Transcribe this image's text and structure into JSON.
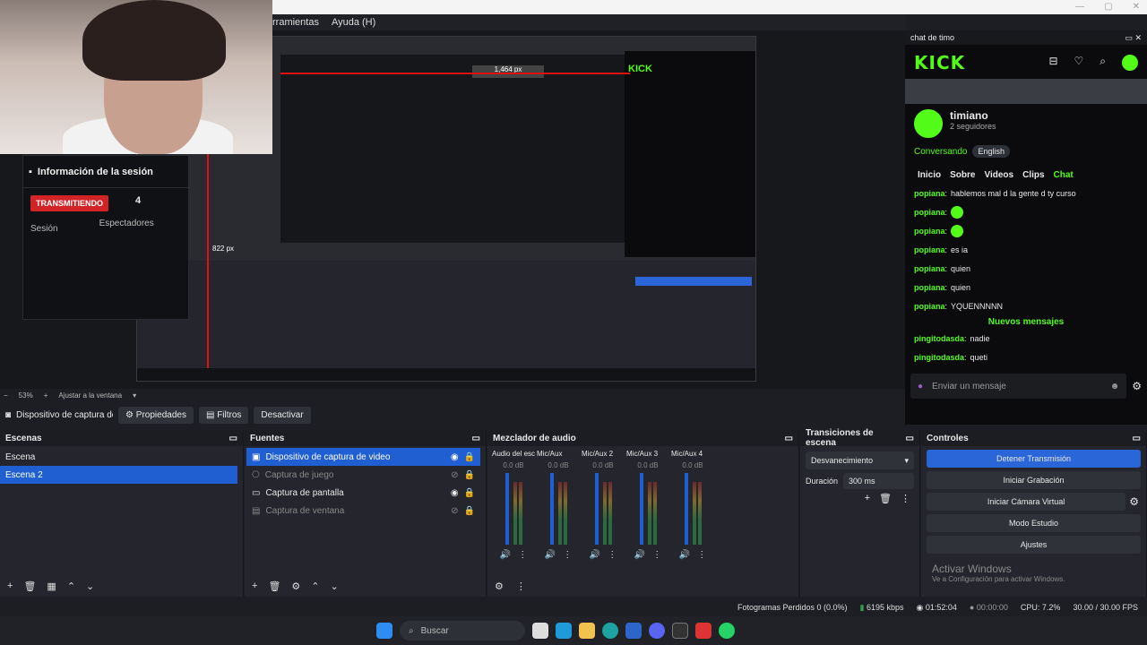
{
  "menubar": {
    "items": [
      "rramientas",
      "Ayuda (H)"
    ]
  },
  "session": {
    "title": "Información de la sesión",
    "live_label": "TRANSMITIENDO",
    "viewers_value": "4",
    "session_label": "Sesión",
    "viewers_label": "Espectadores"
  },
  "preview_overlay": {
    "measure_top": "1,464 px",
    "measure_left": "822 px"
  },
  "zoombar": {
    "zoom": "53%",
    "fit": "Ajustar a la ventana"
  },
  "source_bar": {
    "source_name": "Dispositivo de captura de v",
    "properties": "Propiedades",
    "filters": "Filtros",
    "deactivate": "Desactivar"
  },
  "scenes": {
    "title": "Escenas",
    "items": [
      "Escena",
      "Escena 2"
    ]
  },
  "sources": {
    "title": "Fuentes",
    "items": [
      {
        "label": "Dispositivo de captura de video",
        "enabled": true
      },
      {
        "label": "Captura de juego",
        "enabled": false
      },
      {
        "label": "Captura de pantalla",
        "enabled": true
      },
      {
        "label": "Captura de ventana",
        "enabled": false
      }
    ]
  },
  "mixer": {
    "title": "Mezclador de audio",
    "channels": [
      {
        "name": "Audio del escritorio",
        "db": "0.0 dB"
      },
      {
        "name": "Mic/Aux",
        "db": "0.0 dB"
      },
      {
        "name": "Mic/Aux 2",
        "db": "0.0 dB"
      },
      {
        "name": "Mic/Aux 3",
        "db": "0.0 dB"
      },
      {
        "name": "Mic/Aux 4",
        "db": "0.0 dB"
      }
    ],
    "scale": [
      "-5",
      "-10",
      "-15",
      "-20",
      "-25",
      "-30",
      "-35",
      "-40",
      "-45",
      "-50",
      "-55",
      "-60"
    ]
  },
  "transitions": {
    "title": "Transiciones de escena",
    "selected": "Desvanecimiento",
    "duration_label": "Duración",
    "duration_value": "300 ms"
  },
  "controls": {
    "title": "Controles",
    "buttons": [
      "Detener Transmisión",
      "Iniciar Grabación",
      "Iniciar Cámara Virtual",
      "Modo Estudio",
      "Ajustes"
    ],
    "watermark_title": "Activar Windows",
    "watermark_sub": "Ve a Configuración para activar Windows."
  },
  "chat": {
    "window_title": "chat de timo",
    "logo": "KICK",
    "username": "timiano",
    "followers": "2 seguidores",
    "status": "Conversando",
    "language": "English",
    "tabs": [
      "Inicio",
      "Sobre",
      "Videos",
      "Clips",
      "Chat"
    ],
    "messages": [
      {
        "user": "popiana",
        "text": "hablemos mal d la gente d ty curso",
        "emote": false
      },
      {
        "user": "popiana",
        "text": "",
        "emote": true
      },
      {
        "user": "popiana",
        "text": "",
        "emote": true
      },
      {
        "user": "popiana",
        "text": "es ia",
        "emote": false
      },
      {
        "user": "popiana",
        "text": "quien",
        "emote": false
      },
      {
        "user": "popiana",
        "text": "quien",
        "emote": false
      },
      {
        "user": "popiana",
        "text": "YQUENNNNN",
        "emote": false
      }
    ],
    "new_messages": "Nuevos mensajes",
    "messages_after": [
      {
        "user": "pingitodasda",
        "text": "nadie"
      },
      {
        "user": "pingitodasda",
        "text": "queti"
      }
    ],
    "input_placeholder": "Enviar un mensaje",
    "accent": "#53fc18"
  },
  "status": {
    "dropped": "Fotogramas Perdidos 0 (0.0%)",
    "bitrate": "6195 kbps",
    "live_time": "01:52:04",
    "rec_time": "00:00:00",
    "cpu": "CPU: 7.2%",
    "fps": "30.00 / 30.00 FPS"
  },
  "taskbar": {
    "search_placeholder": "Buscar"
  }
}
